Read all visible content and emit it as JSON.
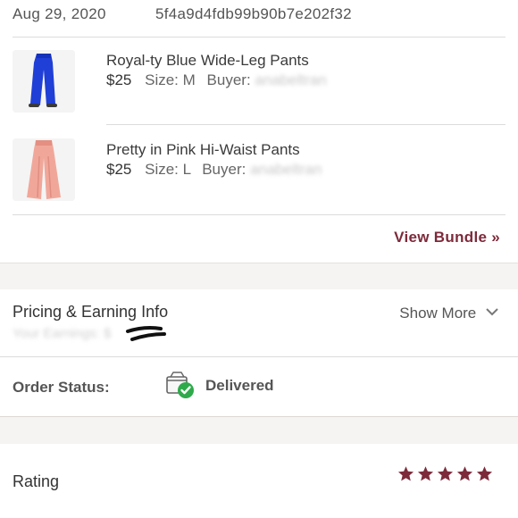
{
  "order": {
    "date": "Aug 29, 2020",
    "id": "5f4a9d4fdb99b90b7e202f32"
  },
  "items": [
    {
      "name": "Royal-ty Blue Wide-Leg Pants",
      "price": "$25",
      "size_label": "Size:",
      "size": "M",
      "buyer_label": "Buyer:",
      "buyer": "anabeltran",
      "image_color": "#1f3fd6"
    },
    {
      "name": "Pretty in Pink Hi-Waist Pants",
      "price": "$25",
      "size_label": "Size:",
      "size": "L",
      "buyer_label": "Buyer:",
      "buyer": "anabeltran",
      "image_color": "#f0a79a"
    }
  ],
  "bundle": {
    "link_label": "View Bundle »"
  },
  "pricing": {
    "title": "Pricing & Earning Info",
    "earnings_label": "Your Earnings: $",
    "show_more_label": "Show More"
  },
  "status": {
    "label": "Order Status:",
    "value": "Delivered",
    "icon": "package-delivered-icon"
  },
  "rating": {
    "label": "Rating",
    "stars": 5,
    "max_stars": 5
  },
  "colors": {
    "accent": "#7d2a3a",
    "success": "#2eaa4a",
    "band": "#f6f4f2"
  }
}
